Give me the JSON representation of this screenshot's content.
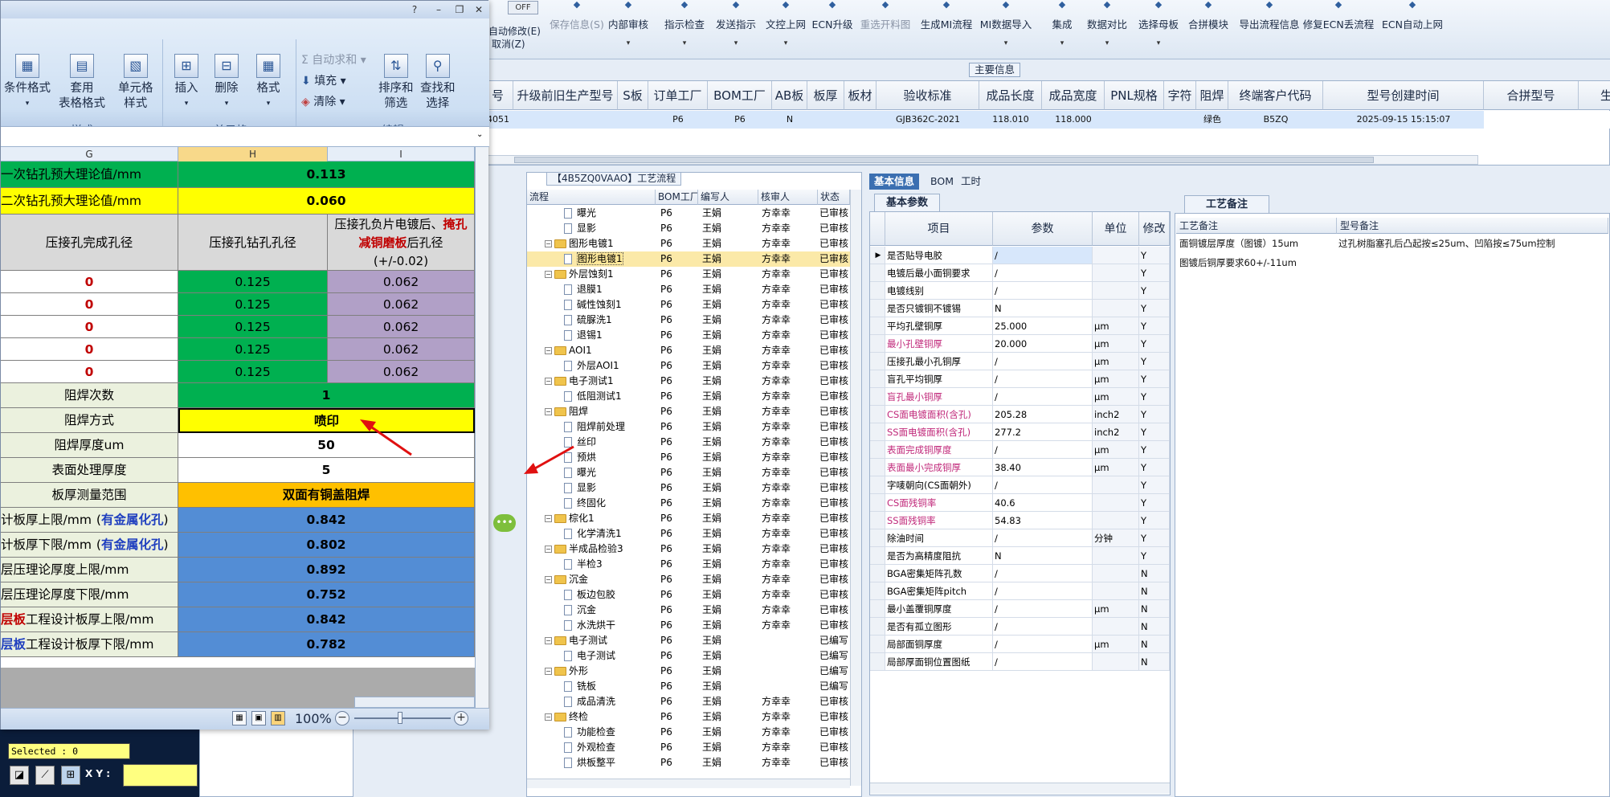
{
  "toolbar": {
    "off_label": "OFF",
    "auto_modify": "自动修改(E)",
    "cancel": "取消(Z)",
    "buttons": [
      {
        "label": "保存信息(S)",
        "disabled": true,
        "icon": "check-icon"
      },
      {
        "label": "内部审核",
        "disabled": false,
        "icon": "audit-icon"
      },
      {
        "label": "指示检查",
        "disabled": false,
        "icon": "check-list-icon"
      },
      {
        "label": "发送指示",
        "disabled": false,
        "icon": "send-icon"
      },
      {
        "label": "文控上网",
        "disabled": false,
        "icon": "upload-icon"
      },
      {
        "label": "ECN升级",
        "disabled": false,
        "icon": "ecn-icon"
      },
      {
        "label": "重选开料图",
        "disabled": true,
        "icon": "image-icon"
      },
      {
        "label": "生成MI流程",
        "disabled": false,
        "icon": "flow-icon"
      },
      {
        "label": "MI数据导入",
        "disabled": false,
        "icon": "import-icon"
      },
      {
        "label": "集成",
        "disabled": false,
        "icon": "integrate-icon"
      },
      {
        "label": "数据对比",
        "disabled": false,
        "icon": "compare-icon"
      },
      {
        "label": "选择母板",
        "disabled": false,
        "icon": "board-icon"
      },
      {
        "label": "合拼模块",
        "disabled": false,
        "icon": "merge-icon"
      },
      {
        "label": "导出流程信息",
        "disabled": false,
        "icon": "export-icon"
      },
      {
        "label": "修复ECN丢流程",
        "disabled": false,
        "icon": "repair-icon"
      },
      {
        "label": "ECN自动上网",
        "disabled": false,
        "icon": "star-icon"
      }
    ]
  },
  "main_info": {
    "label": "主要信息",
    "columns": [
      "号",
      "升级前旧生产型号",
      "S板",
      "订单工厂",
      "BOM工厂",
      "AB板",
      "板厚",
      "板材",
      "验收标准",
      "成品长度",
      "成品宽度",
      "PNL规格",
      "字符",
      "阻焊",
      "终端客户代码",
      "型号创建时间",
      "合拼型号",
      "生产型"
    ],
    "row": [
      "4051",
      "",
      "",
      "P6",
      "P6",
      "N",
      "",
      "",
      "GJB362C-2021",
      "118.010",
      "118.000",
      "",
      "",
      "绿色",
      "B5ZQ",
      "2025-09-15 15:15:07",
      "",
      ""
    ]
  },
  "process": {
    "title": "【4B5ZQ0VAAO】工艺流程",
    "columns": [
      "流程",
      "BOM工厂",
      "编写人",
      "核审人",
      "状态"
    ],
    "rows": [
      {
        "level": 2,
        "type": "page",
        "name": "曝光",
        "bom": "P6",
        "writer": "王娟",
        "checker": "方幸幸",
        "status": "已审核"
      },
      {
        "level": 2,
        "type": "page",
        "name": "显影",
        "bom": "P6",
        "writer": "王娟",
        "checker": "方幸幸",
        "status": "已审核"
      },
      {
        "level": 1,
        "type": "folder",
        "name": "图形电镀1",
        "bom": "P6",
        "writer": "王娟",
        "checker": "方幸幸",
        "status": "已审核"
      },
      {
        "level": 2,
        "type": "page",
        "name": "图形电镀1",
        "bom": "P6",
        "writer": "王娟",
        "checker": "方幸幸",
        "status": "已审核",
        "selected": true
      },
      {
        "level": 1,
        "type": "folder",
        "name": "外层蚀刻1",
        "bom": "P6",
        "writer": "王娟",
        "checker": "方幸幸",
        "status": "已审核"
      },
      {
        "level": 2,
        "type": "page",
        "name": "退膜1",
        "bom": "P6",
        "writer": "王娟",
        "checker": "方幸幸",
        "status": "已审核"
      },
      {
        "level": 2,
        "type": "page",
        "name": "碱性蚀刻1",
        "bom": "P6",
        "writer": "王娟",
        "checker": "方幸幸",
        "status": "已审核"
      },
      {
        "level": 2,
        "type": "page",
        "name": "硫脲洗1",
        "bom": "P6",
        "writer": "王娟",
        "checker": "方幸幸",
        "status": "已审核"
      },
      {
        "level": 2,
        "type": "page",
        "name": "退锡1",
        "bom": "P6",
        "writer": "王娟",
        "checker": "方幸幸",
        "status": "已审核"
      },
      {
        "level": 1,
        "type": "folder",
        "name": "AOI1",
        "bom": "P6",
        "writer": "王娟",
        "checker": "方幸幸",
        "status": "已审核"
      },
      {
        "level": 2,
        "type": "page",
        "name": "外层AOI1",
        "bom": "P6",
        "writer": "王娟",
        "checker": "方幸幸",
        "status": "已审核"
      },
      {
        "level": 1,
        "type": "folder",
        "name": "电子测试1",
        "bom": "P6",
        "writer": "王娟",
        "checker": "方幸幸",
        "status": "已审核"
      },
      {
        "level": 2,
        "type": "page",
        "name": "低阻测试1",
        "bom": "P6",
        "writer": "王娟",
        "checker": "方幸幸",
        "status": "已审核"
      },
      {
        "level": 1,
        "type": "folder",
        "name": "阻焊",
        "bom": "P6",
        "writer": "王娟",
        "checker": "方幸幸",
        "status": "已审核"
      },
      {
        "level": 2,
        "type": "page",
        "name": "阻焊前处理",
        "bom": "P6",
        "writer": "王娟",
        "checker": "方幸幸",
        "status": "已审核"
      },
      {
        "level": 2,
        "type": "page",
        "name": "丝印",
        "bom": "P6",
        "writer": "王娟",
        "checker": "方幸幸",
        "status": "已审核"
      },
      {
        "level": 2,
        "type": "page",
        "name": "预烘",
        "bom": "P6",
        "writer": "王娟",
        "checker": "方幸幸",
        "status": "已审核"
      },
      {
        "level": 2,
        "type": "page",
        "name": "曝光",
        "bom": "P6",
        "writer": "王娟",
        "checker": "方幸幸",
        "status": "已审核"
      },
      {
        "level": 2,
        "type": "page",
        "name": "显影",
        "bom": "P6",
        "writer": "王娟",
        "checker": "方幸幸",
        "status": "已审核"
      },
      {
        "level": 2,
        "type": "page",
        "name": "终固化",
        "bom": "P6",
        "writer": "王娟",
        "checker": "方幸幸",
        "status": "已审核"
      },
      {
        "level": 1,
        "type": "folder",
        "name": "棕化1",
        "bom": "P6",
        "writer": "王娟",
        "checker": "方幸幸",
        "status": "已审核"
      },
      {
        "level": 2,
        "type": "page",
        "name": "化学清洗1",
        "bom": "P6",
        "writer": "王娟",
        "checker": "方幸幸",
        "status": "已审核"
      },
      {
        "level": 1,
        "type": "folder",
        "name": "半成品检验3",
        "bom": "P6",
        "writer": "王娟",
        "checker": "方幸幸",
        "status": "已审核"
      },
      {
        "level": 2,
        "type": "page",
        "name": "半检3",
        "bom": "P6",
        "writer": "王娟",
        "checker": "方幸幸",
        "status": "已审核"
      },
      {
        "level": 1,
        "type": "folder",
        "name": "沉金",
        "bom": "P6",
        "writer": "王娟",
        "checker": "方幸幸",
        "status": "已审核"
      },
      {
        "level": 2,
        "type": "page",
        "name": "板边包胶",
        "bom": "P6",
        "writer": "王娟",
        "checker": "方幸幸",
        "status": "已审核"
      },
      {
        "level": 2,
        "type": "page",
        "name": "沉金",
        "bom": "P6",
        "writer": "王娟",
        "checker": "方幸幸",
        "status": "已审核"
      },
      {
        "level": 2,
        "type": "page",
        "name": "水洗烘干",
        "bom": "P6",
        "writer": "王娟",
        "checker": "方幸幸",
        "status": "已审核"
      },
      {
        "level": 1,
        "type": "folder",
        "name": "电子测试",
        "bom": "P6",
        "writer": "王娟",
        "checker": "",
        "status": "已编写"
      },
      {
        "level": 2,
        "type": "page",
        "name": "电子测试",
        "bom": "P6",
        "writer": "王娟",
        "checker": "",
        "status": "已编写"
      },
      {
        "level": 1,
        "type": "folder",
        "name": "外形",
        "bom": "P6",
        "writer": "王娟",
        "checker": "",
        "status": "已编写"
      },
      {
        "level": 2,
        "type": "page",
        "name": "铣板",
        "bom": "P6",
        "writer": "王娟",
        "checker": "",
        "status": "已编写"
      },
      {
        "level": 2,
        "type": "page",
        "name": "成品清洗",
        "bom": "P6",
        "writer": "王娟",
        "checker": "方幸幸",
        "status": "已审核"
      },
      {
        "level": 1,
        "type": "folder",
        "name": "终检",
        "bom": "P6",
        "writer": "王娟",
        "checker": "方幸幸",
        "status": "已审核"
      },
      {
        "level": 2,
        "type": "page",
        "name": "功能检查",
        "bom": "P6",
        "writer": "王娟",
        "checker": "方幸幸",
        "status": "已审核"
      },
      {
        "level": 2,
        "type": "page",
        "name": "外观检查",
        "bom": "P6",
        "writer": "王娟",
        "checker": "方幸幸",
        "status": "已审核"
      },
      {
        "level": 2,
        "type": "page",
        "name": "烘板整平",
        "bom": "P6",
        "writer": "王娟",
        "checker": "方幸幸",
        "status": "已审核"
      }
    ]
  },
  "basic": {
    "tabs": [
      "基本信息",
      "BOM",
      "工时"
    ],
    "sub_tab": "基本参数",
    "columns": [
      "项目",
      "参数",
      "单位",
      "修改"
    ],
    "rows": [
      {
        "k": "是否贴导电胶",
        "v": "/",
        "u": "",
        "m": "Y",
        "pink": false,
        "current": true
      },
      {
        "k": "电镀后最小面铜要求",
        "v": "/",
        "u": "",
        "m": "Y",
        "pink": false
      },
      {
        "k": "电镀线别",
        "v": "/",
        "u": "",
        "m": "Y",
        "pink": false
      },
      {
        "k": "是否只镀铜不镀锡",
        "v": "N",
        "u": "",
        "m": "Y",
        "pink": false
      },
      {
        "k": "平均孔壁铜厚",
        "v": "25.000",
        "u": "μm",
        "m": "Y",
        "pink": false
      },
      {
        "k": "最小孔壁铜厚",
        "v": "20.000",
        "u": "μm",
        "m": "Y",
        "pink": true
      },
      {
        "k": "压接孔最小孔铜厚",
        "v": "/",
        "u": "μm",
        "m": "Y",
        "pink": false
      },
      {
        "k": "盲孔平均铜厚",
        "v": "/",
        "u": "μm",
        "m": "Y",
        "pink": false
      },
      {
        "k": "盲孔最小铜厚",
        "v": "/",
        "u": "μm",
        "m": "Y",
        "pink": true
      },
      {
        "k": "CS面电镀面积(含孔)",
        "v": "205.28",
        "u": "inch2",
        "m": "Y",
        "pink": true
      },
      {
        "k": "SS面电镀面积(含孔)",
        "v": "277.2",
        "u": "inch2",
        "m": "Y",
        "pink": true
      },
      {
        "k": "表面完成铜厚度",
        "v": "/",
        "u": "μm",
        "m": "Y",
        "pink": true
      },
      {
        "k": "表面最小完成铜厚",
        "v": "38.40",
        "u": "μm",
        "m": "Y",
        "pink": true
      },
      {
        "k": "字唛朝向(CS面朝外)",
        "v": "/",
        "u": "",
        "m": "Y",
        "pink": false
      },
      {
        "k": "CS面残铜率",
        "v": "40.6",
        "u": "",
        "m": "Y",
        "pink": true
      },
      {
        "k": "SS面残铜率",
        "v": "54.83",
        "u": "",
        "m": "Y",
        "pink": true
      },
      {
        "k": "除油时间",
        "v": "/",
        "u": "分钟",
        "m": "Y",
        "pink": false
      },
      {
        "k": "是否为高精度阻抗",
        "v": "N",
        "u": "",
        "m": "Y",
        "pink": false
      },
      {
        "k": "BGA密集矩阵孔数",
        "v": "/",
        "u": "",
        "m": "N",
        "pink": false
      },
      {
        "k": "BGA密集矩阵pitch",
        "v": "/",
        "u": "",
        "m": "N",
        "pink": false
      },
      {
        "k": "最小盖覆铜厚度",
        "v": "/",
        "u": "μm",
        "m": "N",
        "pink": false
      },
      {
        "k": "是否有孤立图形",
        "v": "/",
        "u": "",
        "m": "N",
        "pink": false
      },
      {
        "k": "局部面铜厚度",
        "v": "/",
        "u": "μm",
        "m": "N",
        "pink": false
      },
      {
        "k": "局部厚面铜位置图纸",
        "v": "/",
        "u": "",
        "m": "N",
        "pink": false
      }
    ]
  },
  "remark": {
    "tab": "工艺备注",
    "columns": [
      "工艺备注",
      "型号备注"
    ],
    "process_notes": [
      "面铜镀层厚度（图镀）15um",
      "图镀后铜厚要求60+/-11um"
    ],
    "model_note": "过孔树脂塞孔后凸起按≤25um、凹陷按≤75um控制"
  },
  "bottom_left": {
    "selected": "Selected : 0",
    "xy_label": "X Y :"
  },
  "excel": {
    "ribbon": {
      "style_group": {
        "label": "样式",
        "cond_format": "条件格式",
        "table_format_1": "套用",
        "table_format_2": "表格格式",
        "cell_style_1": "单元格",
        "cell_style_2": "样式"
      },
      "cells_group": {
        "label": "单元格",
        "insert": "插入",
        "delete": "删除",
        "format": "格式"
      },
      "edit_group": {
        "label": "编辑",
        "autosum": "Σ 自动求和",
        "fill": "填充",
        "clear": "清除",
        "sort_1": "排序和",
        "sort_2": "筛选",
        "find_1": "查找和",
        "find_2": "选择"
      }
    },
    "col_headers": [
      "G",
      "H",
      "I"
    ],
    "rows": [
      {
        "g": "一次钻孔预大理论值/mm",
        "h": "0.113",
        "gc": "g",
        "hc": "g"
      },
      {
        "g": "二次钻孔预大理论值/mm",
        "h": "0.060",
        "gc": "y",
        "hc": "y"
      },
      {
        "g": "压接孔完成孔径",
        "h": "压接孔钻孔孔径",
        "i1": "压接孔负片电镀后、",
        "i2": "掩孔",
        "i3": "减铜磨板",
        "i4": "后孔径",
        "i5": "(+/-0.02)"
      },
      {
        "g": "0",
        "h": "0.125",
        "i": "0.062"
      },
      {
        "g": "0",
        "h": "0.125",
        "i": "0.062"
      },
      {
        "g": "0",
        "h": "0.125",
        "i": "0.062"
      },
      {
        "g": "0",
        "h": "0.125",
        "i": "0.062"
      },
      {
        "g": "0",
        "h": "0.125",
        "i": "0.062"
      },
      {
        "g": "阻焊次数",
        "h": "1",
        "hc": "g"
      },
      {
        "g": "阻焊方式",
        "h": "喷印",
        "hc": "y"
      },
      {
        "g": "阻焊厚度um",
        "h": "50",
        "hc": "w"
      },
      {
        "g": "表面处理厚度",
        "h": "5",
        "hc": "w"
      },
      {
        "g": "板厚测量范围",
        "h": "双面有铜盖阻焊",
        "hc": "o"
      },
      {
        "g": "计板厚上限/mm",
        "g2": "有金属化孔",
        "h": "0.842",
        "hc": "b"
      },
      {
        "g": "计板厚下限/mm",
        "g2": "有金属化孔",
        "h": "0.802",
        "hc": "b"
      },
      {
        "g": "层压理论厚度上限/mm",
        "h": "0.892",
        "hc": "b"
      },
      {
        "g": "层压理论厚度下限/mm",
        "h": "0.752",
        "hc": "b"
      },
      {
        "g0": "层板",
        "g": "工程设计板厚上限/mm",
        "h": "0.842",
        "hc": "b"
      },
      {
        "g0": "层板",
        "g": "工程设计板厚下限/mm",
        "h": "0.782",
        "hc": "b"
      }
    ],
    "zoom": "100%"
  }
}
